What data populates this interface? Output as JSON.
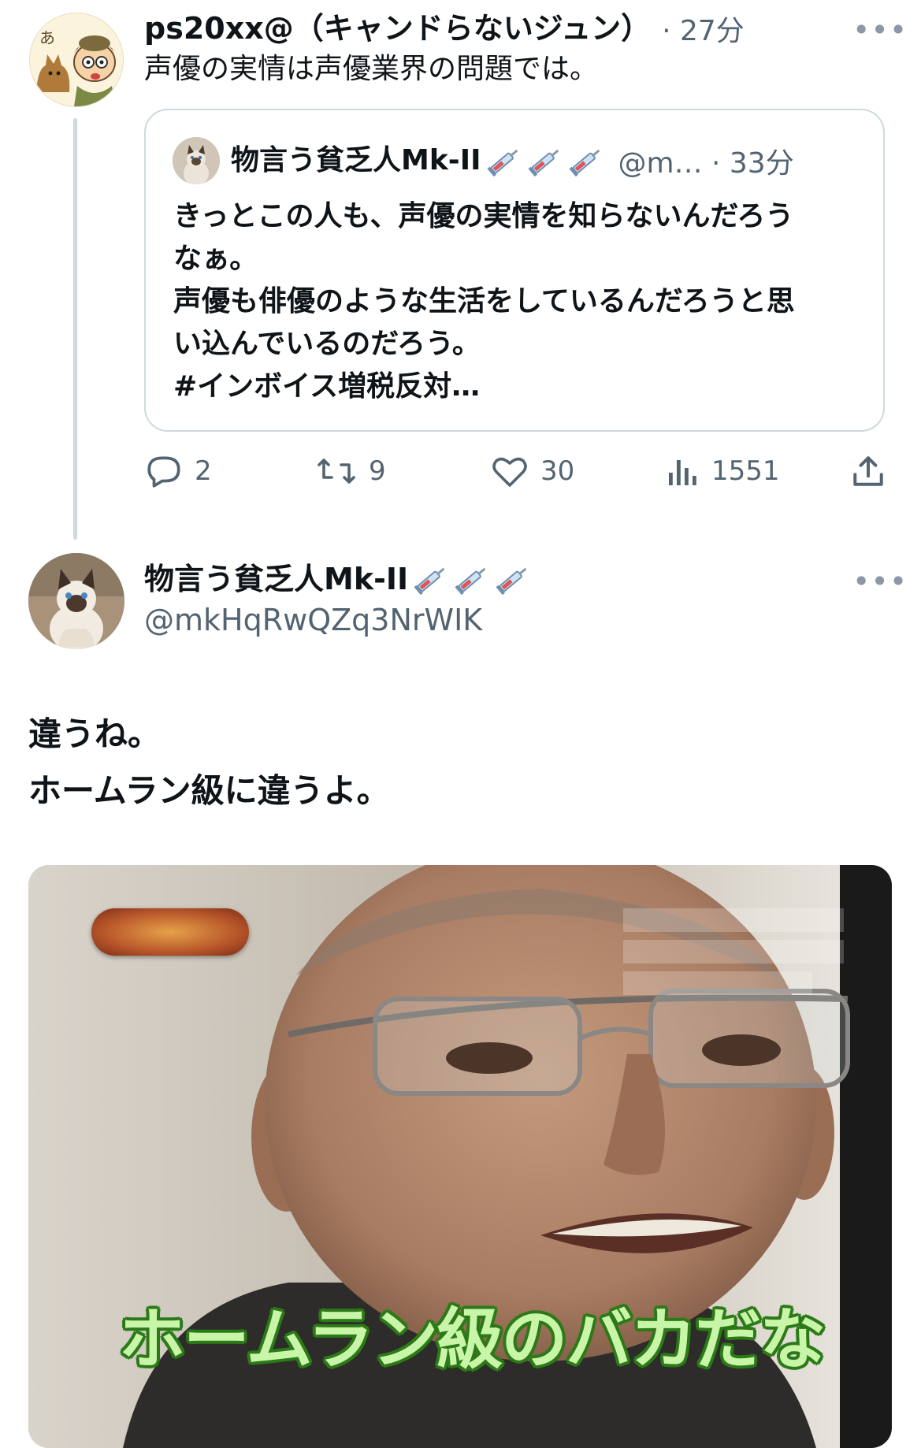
{
  "parent_tweet": {
    "display_name": "ps20xx@（キャンドらないジュン）",
    "time": "· 27分",
    "text": "声優の実情は声優業界の問題では。",
    "more_label": "•••"
  },
  "quoted_tweet": {
    "display_name": "物言う貧乏人Mk-II",
    "handle_time": "@m… · 33分",
    "lines": [
      "きっとこの人も、声優の実情を知らないんだろう",
      "なぁ。",
      "声優も俳優のような生活をしているんだろうと思",
      "い込んでいるのだろう。",
      "#インボイス増税反対…"
    ]
  },
  "actions": {
    "replies": "2",
    "retweets": "9",
    "likes": "30",
    "views": "1551"
  },
  "main_tweet": {
    "display_name": "物言う貧乏人Mk-II",
    "handle": "@mkHqRwQZq3NrWIK",
    "more_label": "•••",
    "lines": [
      "違うね。",
      "ホームラン級に違うよ。"
    ]
  },
  "media": {
    "caption": "ホームラン級のバカだな"
  },
  "colors": {
    "text": "#0f1419",
    "muted": "#536471",
    "border": "#cfd9de",
    "caption_fill": "#c9f5a9",
    "caption_outline": "#2c7a18"
  }
}
